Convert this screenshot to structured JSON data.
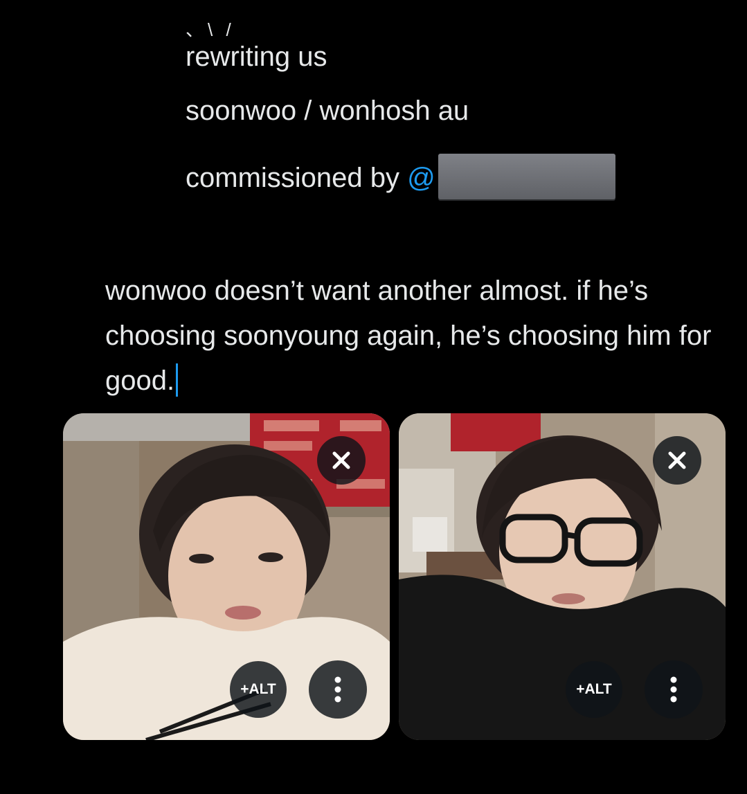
{
  "compose": {
    "deco_marks": "、\\ /",
    "title_line": "rewriting us",
    "pairing_line": "soonwoo / wonhosh au",
    "commission_prefix": "commissioned by ",
    "mention_symbol": "@",
    "body": "wonwoo doesn’t want another almost. if he’s choosing soonyoung again, he’s choosing him for good."
  },
  "media": [
    {
      "alt_label": "+ALT"
    },
    {
      "alt_label": "+ALT"
    }
  ],
  "icons": {
    "remove": "close-icon",
    "more": "more-vertical-icon"
  },
  "colors": {
    "background": "#000000",
    "text": "#e7e9ea",
    "accent": "#1d9bf0",
    "button_bg": "#0f1419"
  }
}
